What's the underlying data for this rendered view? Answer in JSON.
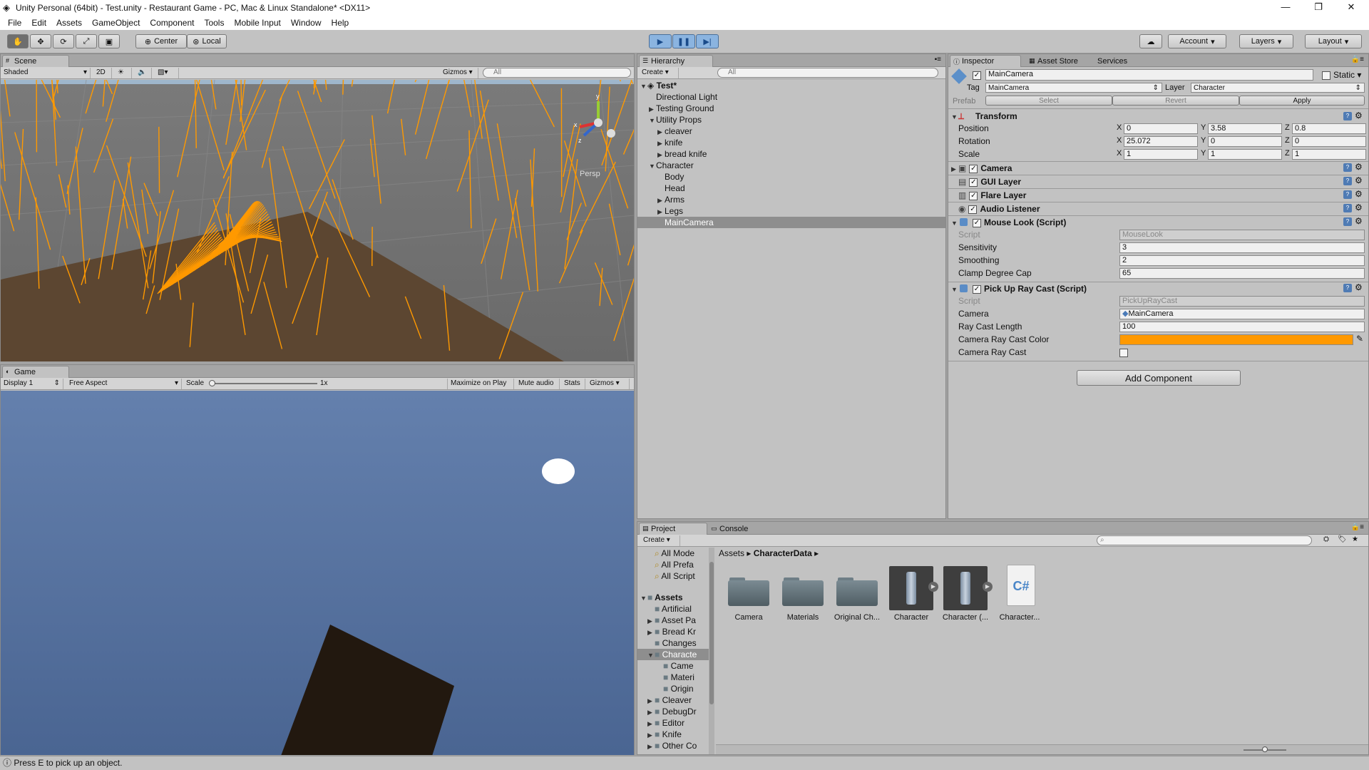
{
  "window": {
    "title": "Unity Personal (64bit) - Test.unity - Restaurant Game - PC, Mac & Linux Standalone* <DX11>",
    "minimize": "—",
    "maximize": "❐",
    "close": "✕"
  },
  "menu": [
    "File",
    "Edit",
    "Assets",
    "GameObject",
    "Component",
    "Tools",
    "Mobile Input",
    "Window",
    "Help"
  ],
  "toolbar": {
    "pivot": "Center",
    "space": "Local",
    "account": "Account",
    "layers": "Layers",
    "layout": "Layout"
  },
  "scene": {
    "tab": "Scene",
    "shading": "Shaded",
    "mode2d": "2D",
    "gizmos": "Gizmos",
    "search_placeholder": "All",
    "persp": "Persp"
  },
  "game": {
    "tab": "Game",
    "display": "Display 1",
    "aspect": "Free Aspect",
    "scale_label": "Scale",
    "scale_value": "1x",
    "maximize": "Maximize on Play",
    "mute": "Mute audio",
    "stats": "Stats",
    "gizmos": "Gizmos"
  },
  "hierarchy": {
    "tab": "Hierarchy",
    "create": "Create",
    "search_placeholder": "All",
    "scene_name": "Test*",
    "items": [
      {
        "label": "Directional Light",
        "arrow": ""
      },
      {
        "label": "Testing Ground",
        "arrow": "▶"
      },
      {
        "label": "Utility Props",
        "arrow": "▼"
      },
      {
        "label": "cleaver",
        "arrow": "▶"
      },
      {
        "label": "knife",
        "arrow": "▶"
      },
      {
        "label": "bread knife",
        "arrow": "▶"
      },
      {
        "label": "Character",
        "arrow": "▼"
      },
      {
        "label": "Body",
        "arrow": ""
      },
      {
        "label": "Head",
        "arrow": ""
      },
      {
        "label": "Arms",
        "arrow": "▶"
      },
      {
        "label": "Legs",
        "arrow": "▶"
      },
      {
        "label": "MainCamera",
        "arrow": "",
        "selected": true
      }
    ]
  },
  "inspector": {
    "tab": "Inspector",
    "tab2": "Asset Store",
    "tab3": "Services",
    "object_name": "MainCamera",
    "static_label": "Static",
    "tag_label": "Tag",
    "tag_value": "MainCamera",
    "layer_label": "Layer",
    "layer_value": "Character",
    "prefab_label": "Prefab",
    "prefab_select": "Select",
    "prefab_revert": "Revert",
    "prefab_apply": "Apply",
    "transform": {
      "title": "Transform",
      "position_label": "Position",
      "rotation_label": "Rotation",
      "scale_label": "Scale",
      "position": [
        "0",
        "3.58",
        "0.8"
      ],
      "rotation": [
        "25.072",
        "0",
        "0"
      ],
      "scale": [
        "1",
        "1",
        "1"
      ],
      "axes": [
        "X",
        "Y",
        "Z"
      ]
    },
    "components": [
      "Camera",
      "GUI Layer",
      "Flare Layer",
      "Audio Listener"
    ],
    "mouse_look": {
      "title": "Mouse Look (Script)",
      "script_label": "Script",
      "script_value": "MouseLook",
      "sensitivity_label": "Sensitivity",
      "sensitivity": "3",
      "smoothing_label": "Smoothing",
      "smoothing": "2",
      "clamp_label": "Clamp Degree Cap",
      "clamp": "65"
    },
    "pickup": {
      "title": "Pick Up Ray Cast (Script)",
      "script_label": "Script",
      "script_value": "PickUpRayCast",
      "camera_label": "Camera",
      "camera_value": "MainCamera",
      "length_label": "Ray Cast Length",
      "length": "100",
      "color_label": "Camera Ray Cast Color",
      "color": "#ff9900",
      "raycast_label": "Camera Ray Cast"
    },
    "add_component": "Add Component"
  },
  "project": {
    "tab": "Project",
    "tab2": "Console",
    "create": "Create",
    "favorites": [
      "All Mode",
      "All Prefa",
      "All Script"
    ],
    "assets_root": "Assets",
    "tree": [
      {
        "label": "Artificial",
        "arrow": ""
      },
      {
        "label": "Asset Pa",
        "arrow": "▶"
      },
      {
        "label": "Bread Kr",
        "arrow": "▶"
      },
      {
        "label": "Changes",
        "arrow": ""
      },
      {
        "label": "Characte",
        "arrow": "▼",
        "selected": true
      },
      {
        "label": "Came",
        "arrow": "",
        "indent": true
      },
      {
        "label": "Materi",
        "arrow": "",
        "indent": true
      },
      {
        "label": "Origin",
        "arrow": "",
        "indent": true
      },
      {
        "label": "Cleaver",
        "arrow": "▶"
      },
      {
        "label": "DebugDr",
        "arrow": "▶"
      },
      {
        "label": "Editor",
        "arrow": "▶"
      },
      {
        "label": "Knife",
        "arrow": "▶"
      },
      {
        "label": "Other Co",
        "arrow": "▶"
      }
    ],
    "breadcrumb_root": "Assets",
    "breadcrumb_current": "CharacterData",
    "assets": [
      {
        "label": "Camera",
        "kind": "folder"
      },
      {
        "label": "Materials",
        "kind": "folder"
      },
      {
        "label": "Original Ch...",
        "kind": "folder"
      },
      {
        "label": "Character",
        "kind": "prefab"
      },
      {
        "label": "Character (...",
        "kind": "prefab"
      },
      {
        "label": "Character...",
        "kind": "script",
        "glyph": "C#"
      }
    ]
  },
  "status": {
    "message": "Press E to pick up an object."
  },
  "colors": {
    "accent_orange": "#ff9900",
    "ground": "#5c4631",
    "sky": "#5c79a6"
  }
}
